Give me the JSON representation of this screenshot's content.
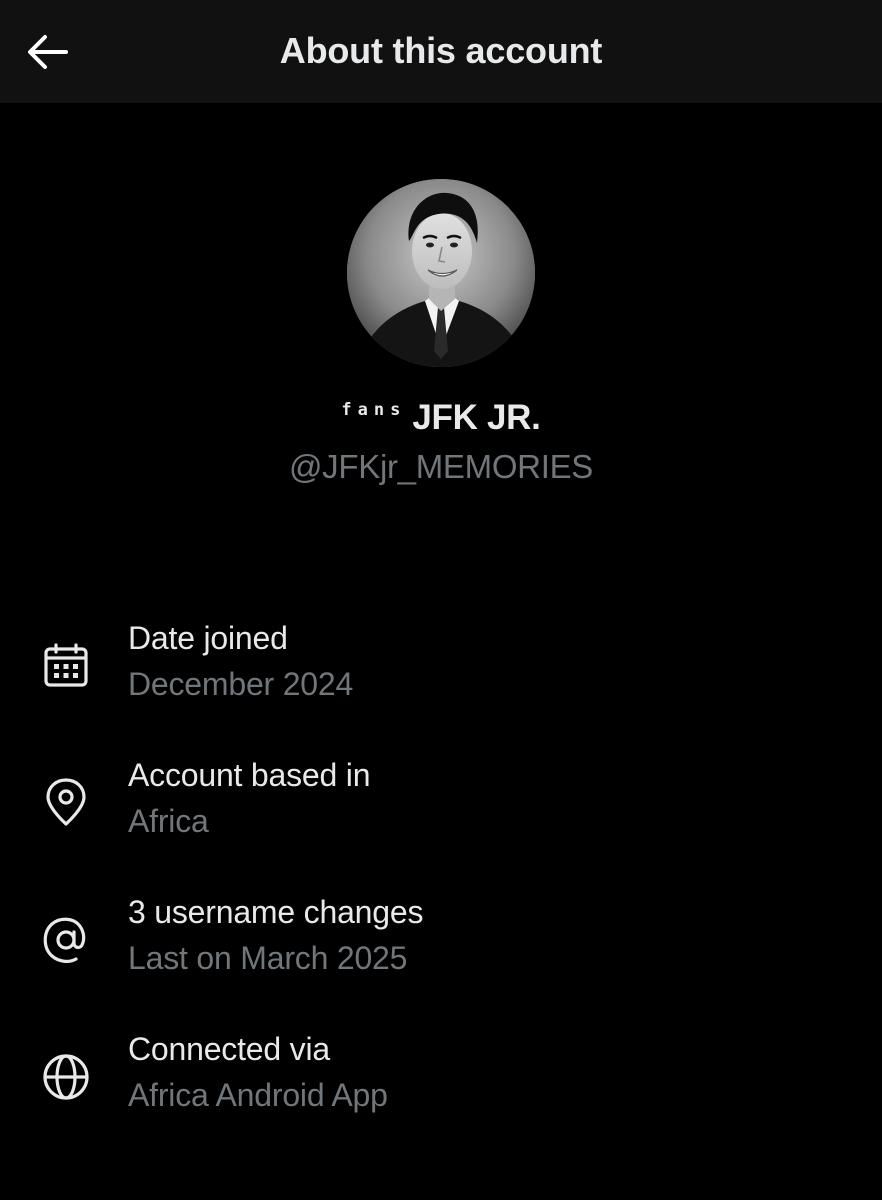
{
  "header": {
    "back_icon": "arrow-left-icon",
    "title": "About this account"
  },
  "profile": {
    "avatar_icon": "profile-photo",
    "name_prefix": "fans",
    "name_main": "JFK JR.",
    "handle": "@JFKjr_MEMORIES"
  },
  "info": [
    {
      "icon": "calendar-icon",
      "label": "Date joined",
      "value": "December 2024"
    },
    {
      "icon": "location-pin-icon",
      "label": "Account based in",
      "value": "Africa"
    },
    {
      "icon": "at-sign-icon",
      "label": "3 username changes",
      "value": "Last on March 2025"
    },
    {
      "icon": "globe-icon",
      "label": "Connected via",
      "value": "Africa Android App"
    }
  ],
  "colors": {
    "background": "#000000",
    "header_background": "#111111",
    "primary_text": "#e7e9ea",
    "secondary_text": "#71767b"
  }
}
